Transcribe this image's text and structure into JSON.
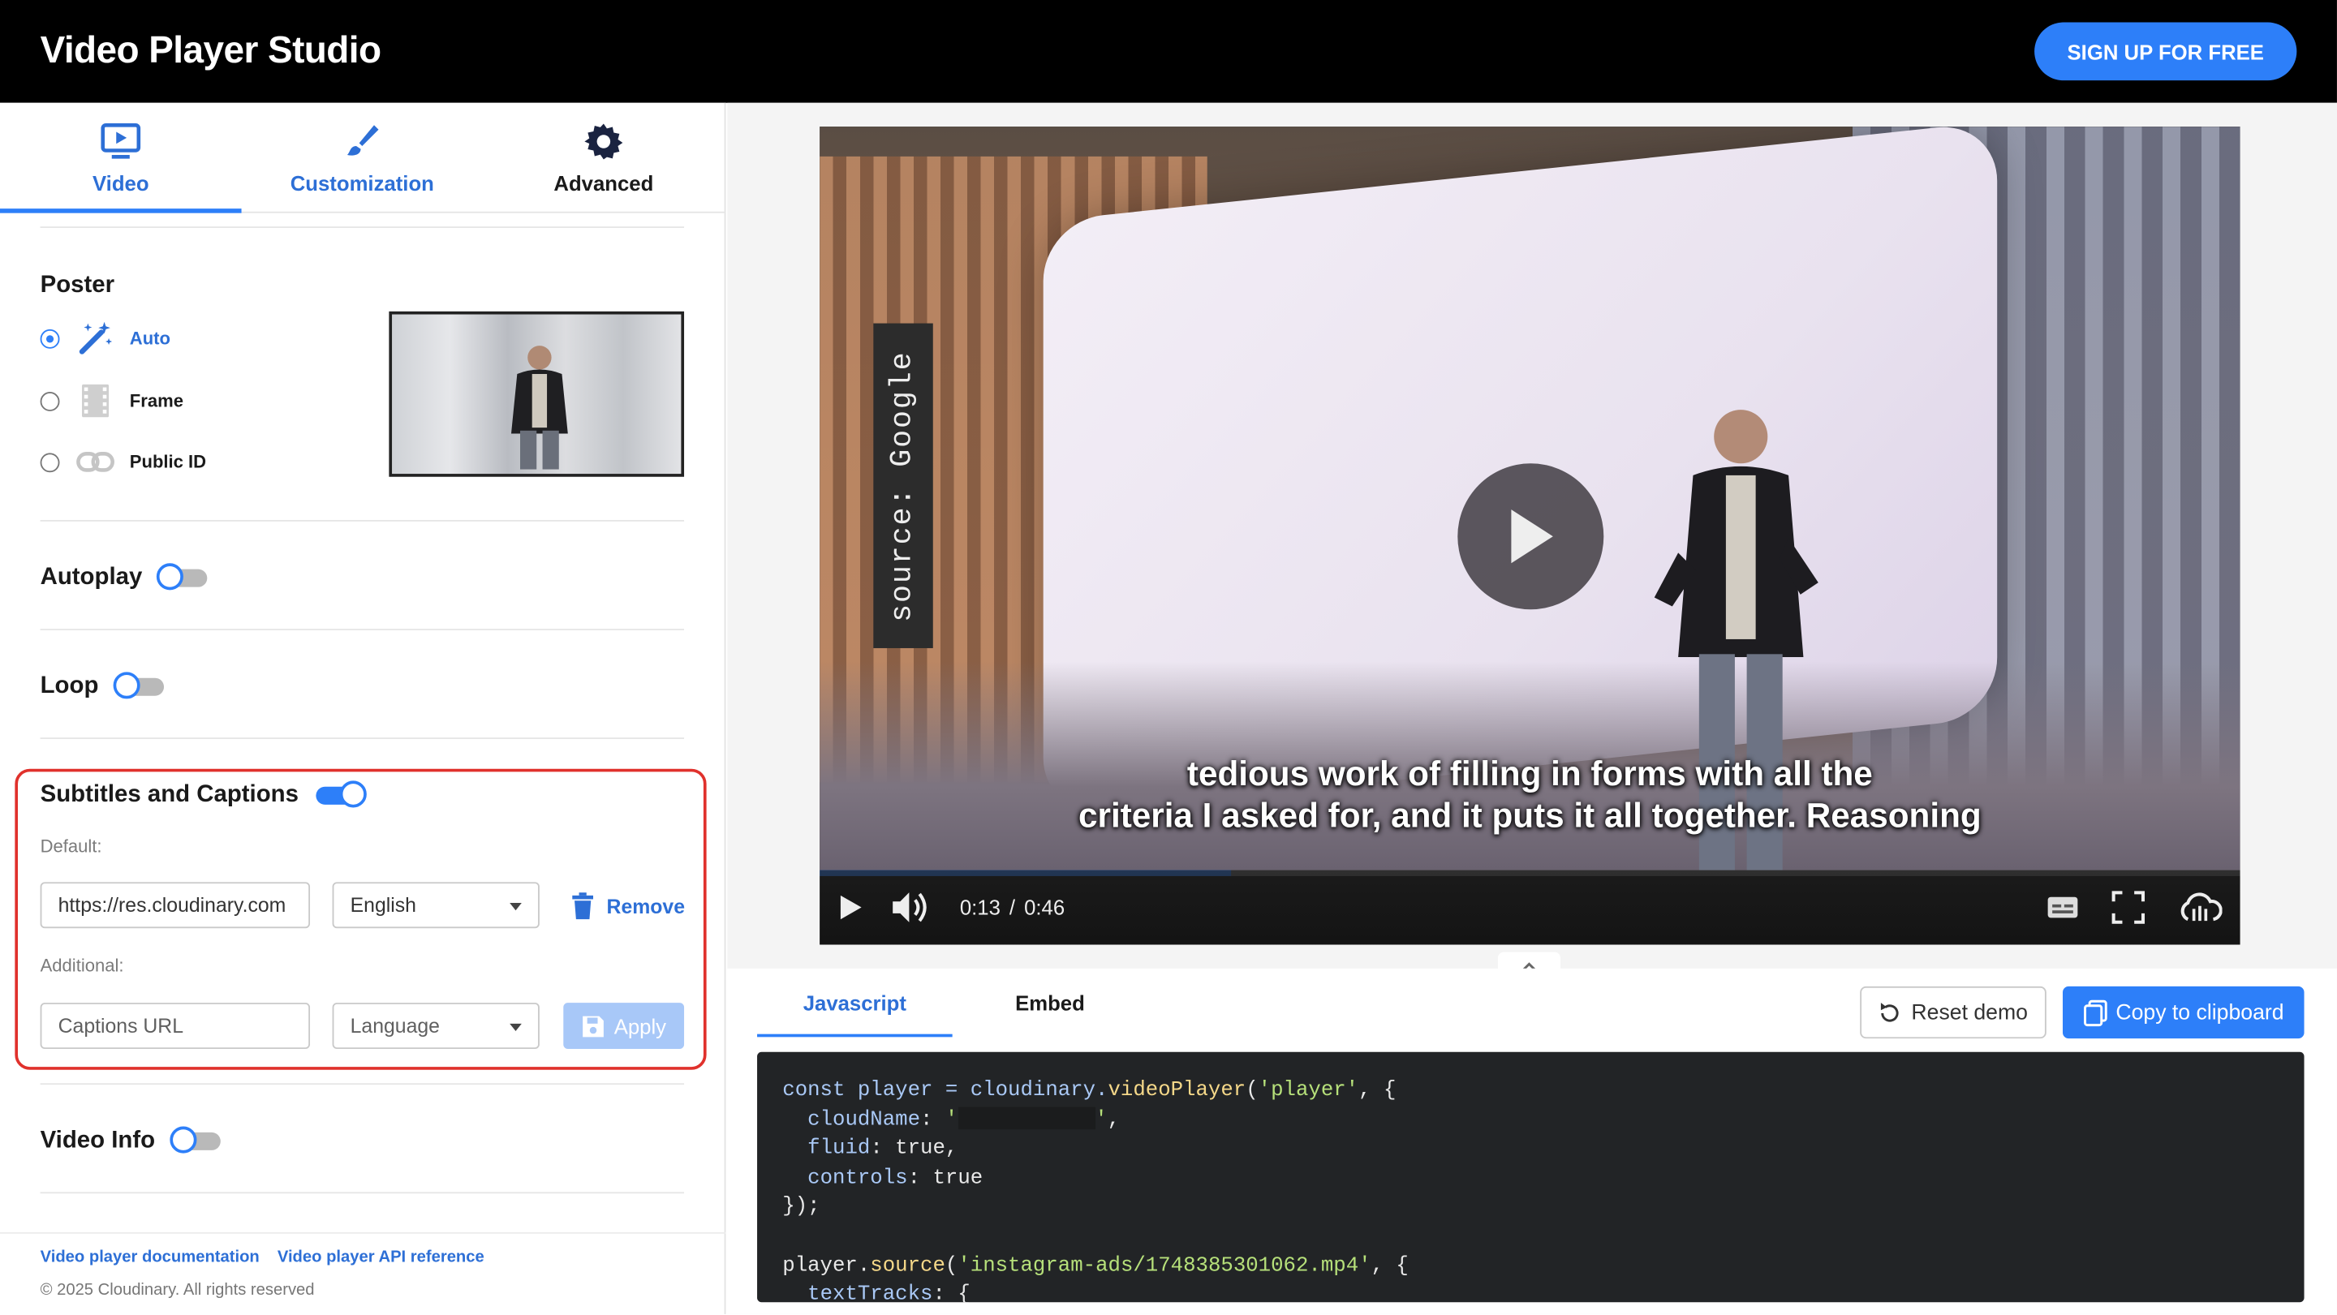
{
  "header": {
    "title": "Video Player Studio",
    "signup_label": "SIGN UP FOR FREE"
  },
  "tabs": [
    {
      "label": "Video",
      "icon": "video-monitor-icon",
      "active": true
    },
    {
      "label": "Customization",
      "icon": "brush-icon",
      "active": false
    },
    {
      "label": "Advanced",
      "icon": "gear-icon",
      "active": false
    }
  ],
  "poster": {
    "title": "Poster",
    "options": [
      {
        "label": "Auto",
        "icon": "magic-wand-icon",
        "selected": true
      },
      {
        "label": "Frame",
        "icon": "film-frame-icon",
        "selected": false
      },
      {
        "label": "Public ID",
        "icon": "link-icon",
        "selected": false
      }
    ]
  },
  "autoplay": {
    "label": "Autoplay",
    "on": false
  },
  "loop": {
    "label": "Loop",
    "on": false
  },
  "captions": {
    "label": "Subtitles and Captions",
    "on": true,
    "default_label": "Default:",
    "default_url": "https://res.cloudinary.com",
    "default_language": "English",
    "remove_label": "Remove",
    "additional_label": "Additional:",
    "url_placeholder": "Captions URL",
    "language_placeholder": "Language",
    "apply_label": "Apply"
  },
  "video_info": {
    "label": "Video Info",
    "on": false
  },
  "footer": {
    "doc_link": "Video player documentation",
    "api_link": "Video player API reference",
    "copyright": "© 2025 Cloudinary. All rights reserved"
  },
  "player": {
    "source_tag": "source: Google",
    "subtitle_line1": "tedious work of filling in forms with all the",
    "subtitle_line2": "criteria I asked for, and it puts it all together. Reasoning",
    "current_time": "0:13",
    "separator": "/",
    "duration": "0:46",
    "progress": 0.29
  },
  "code_panel": {
    "tab_js": "Javascript",
    "tab_embed": "Embed",
    "reset_label": "Reset demo",
    "copy_label": "Copy to clipboard",
    "line1_a": "const player = cloudinary.",
    "line1_fn": "videoPlayer",
    "line1_b": "(",
    "line1_str": "'player'",
    "line1_c": ", {",
    "line2_prop": "cloudName",
    "line2_a": ": ",
    "line2_str_open": "'",
    "line2_str_close": "'",
    "line2_b": ",",
    "line3_prop": "fluid",
    "line3_a": ": true,",
    "line4_prop": "controls",
    "line4_a": ": true",
    "line5": "});",
    "line7_a": "player.",
    "line7_fn": "source",
    "line7_b": "(",
    "line7_str": "'instagram-ads/1748385301062.mp4'",
    "line7_c": ", {",
    "line8_prop": "textTracks",
    "line8_a": ": {"
  }
}
